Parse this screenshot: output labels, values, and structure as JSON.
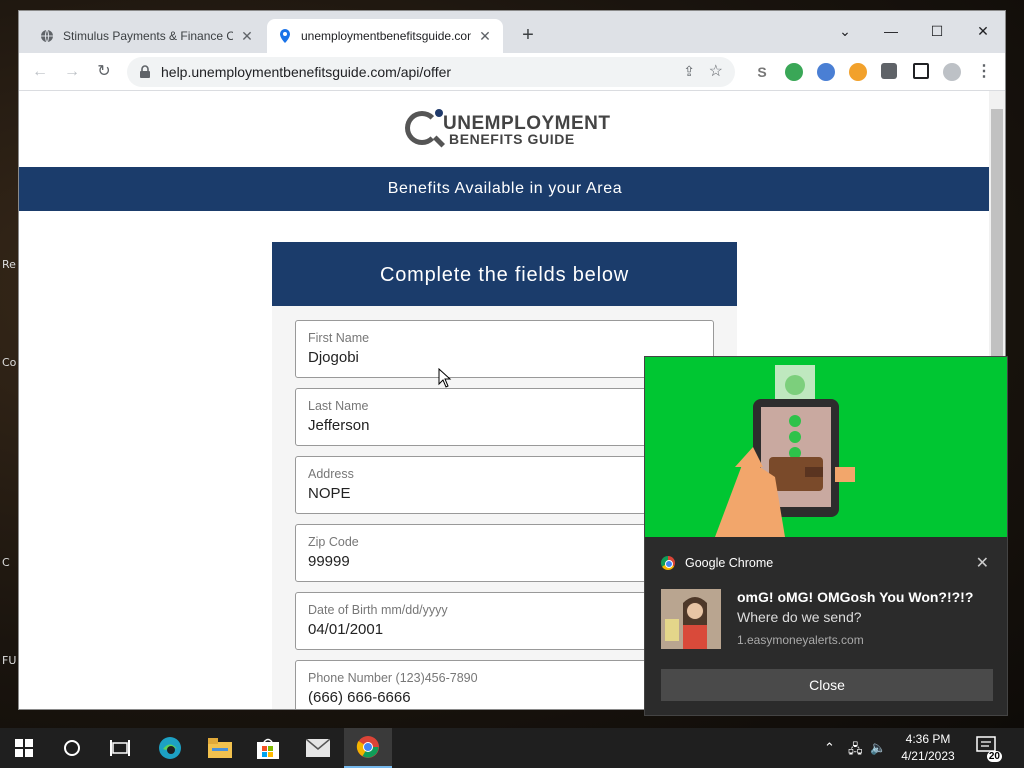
{
  "desktop": {
    "labels": [
      "Re",
      "Co",
      "C",
      "FU"
    ]
  },
  "browser": {
    "tabs": [
      {
        "title": "Stimulus Payments & Finance Offers",
        "favicon": "globe-icon",
        "close": "✕"
      },
      {
        "title": "unemploymentbenefitsguide.com",
        "favicon": "location-pin-icon",
        "close": "✕"
      }
    ],
    "new_tab": "+",
    "window_controls": {
      "tab_search": "⌄",
      "minimize": "—",
      "maximize": "☐",
      "close": "✕"
    },
    "url": "help.unemploymentbenefitsguide.com/api/offer"
  },
  "page": {
    "logo_line1": "UNEMPLOYMENT",
    "logo_line2": "BENEFITS GUIDE",
    "banner": "Benefits Available in your Area",
    "form_header": "Complete the fields below",
    "fields": [
      {
        "label": "First Name",
        "value": "Djogobi"
      },
      {
        "label": "Last Name",
        "value": "Jefferson"
      },
      {
        "label": "Address",
        "value": "NOPE"
      },
      {
        "label": "Zip Code",
        "value": "99999"
      },
      {
        "label": "Date of Birth mm/dd/yyyy",
        "value": "04/01/2001"
      },
      {
        "label": "Phone Number (123)456-7890",
        "value": "(666) 666-6666"
      }
    ]
  },
  "notification": {
    "app": "Google Chrome",
    "close_x": "✕",
    "title": "omG! oMG! OMGosh You Won?!?!?",
    "body": "Where do we send?",
    "source": "1.easymoneyalerts.com",
    "button": "Close"
  },
  "taskbar": {
    "time": "4:36 PM",
    "date": "4/21/2023",
    "notification_count": "20"
  },
  "colors": {
    "brand_navy": "#1b3c6b",
    "hero_green": "#00c632"
  }
}
